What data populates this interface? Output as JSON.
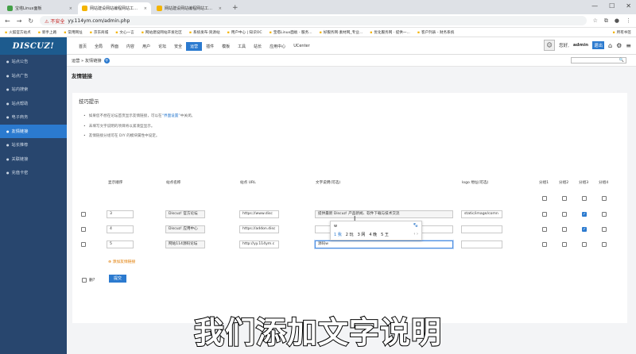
{
  "browser": {
    "tabs": [
      {
        "title": "宝塔Linux面板",
        "color": "#43a047",
        "active": false
      },
      {
        "title": "网站建设网站编程网站工具技术",
        "color": "#f4b400",
        "active": true
      },
      {
        "title": "网站建设网站编程网站工具技术",
        "color": "#f4b400",
        "active": false
      }
    ],
    "new_tab": "+",
    "url_warning": "⚠ 不安全",
    "url": "yy.114ym.com/admin.php",
    "bookmarks": [
      "火狐官方站点",
      "新手上路",
      "常用网址",
      "京东商城",
      "文心一言",
      "网站建设网站开发社区",
      "系统发布·资源站",
      "用户中心 | 知识OC",
      "宝塔Linux面板 - 服务...",
      "好服务网·素材网_专业...",
      "优化服务网 · 提供一...",
      "客户列表 - 财务系统"
    ],
    "other_bookmarks": "所有书签"
  },
  "header": {
    "logo": "DISCUZ!",
    "nav": [
      "首页",
      "全局",
      "界面",
      "内容",
      "用户",
      "论坛",
      "安全",
      "运营",
      "插件",
      "模板",
      "工具",
      "站长",
      "应用中心",
      "UCenter"
    ],
    "current_nav": "运营",
    "greeting": "您好,",
    "username": "admin",
    "logout": "退出",
    "home_icon": "⌂",
    "gear_icon": "⚙",
    "menu_icon": "≡"
  },
  "crumb": {
    "text": "运营 » 友情链接",
    "plus": "+",
    "search_icon": "🔍"
  },
  "sidebar": [
    {
      "label": "站点公告",
      "current": false
    },
    {
      "label": "站点广告",
      "current": false
    },
    {
      "label": "站内搜索",
      "current": false
    },
    {
      "label": "站点帮助",
      "current": false
    },
    {
      "label": "电子商务",
      "current": false
    },
    {
      "label": "友情链接",
      "current": true
    },
    {
      "label": "站长推荐",
      "current": false
    },
    {
      "label": "关联链接",
      "current": false
    },
    {
      "label": "充值卡密",
      "current": false
    }
  ],
  "page": {
    "title": "友情链接",
    "tips_title": "技巧提示",
    "tips": [
      {
        "before": "如果您不想在论坛首页显示友情链接，可以在",
        "link": "“界面设置”",
        "after": "中关闭。"
      },
      {
        "before": "未填写文字说明的项目将以紧凑型显示。",
        "link": "",
        "after": ""
      },
      {
        "before": "友情链接分组可在 DIY 的模块属性中设定。",
        "link": "",
        "after": ""
      }
    ]
  },
  "table": {
    "headers": {
      "del": "删?",
      "order": "显示顺序",
      "name": "站点名称",
      "url": "站点 URL",
      "desc": "文字说明(可选)",
      "logo": "logo 地址(可选)",
      "g1": "分组1",
      "g2": "分组2",
      "g3": "分组3",
      "g4": "分组4"
    },
    "rows": [
      {
        "order": "3",
        "name": "Discuz! 官方论坛",
        "url": "https://www.disc",
        "desc": "提供最新 Discuz! 产品新闻、软件下载与技术交流",
        "logo": "static/image/comn",
        "groups": [
          false,
          false,
          true,
          false
        ]
      },
      {
        "order": "4",
        "name": "Discuz! 应用中心",
        "url": "https://addon.disc",
        "desc": "",
        "logo": "",
        "groups": [
          false,
          false,
          true,
          false
        ]
      },
      {
        "order": "5",
        "name": "网站114源码论坛",
        "url": "http://yy.114ym.c",
        "desc": "源码w",
        "logo": "",
        "groups": [
          false,
          false,
          false,
          false
        ]
      }
    ],
    "add_link": "添加友情链接",
    "delete_label": "删?",
    "submit": "提交"
  },
  "ime": {
    "composition": "w",
    "candidates": [
      "1 我",
      "2 玩",
      "3 网",
      "4 晚",
      "5 王"
    ],
    "nav": "‹ ›",
    "logo": "🐾"
  },
  "subtitle": "我们添加文字说明"
}
